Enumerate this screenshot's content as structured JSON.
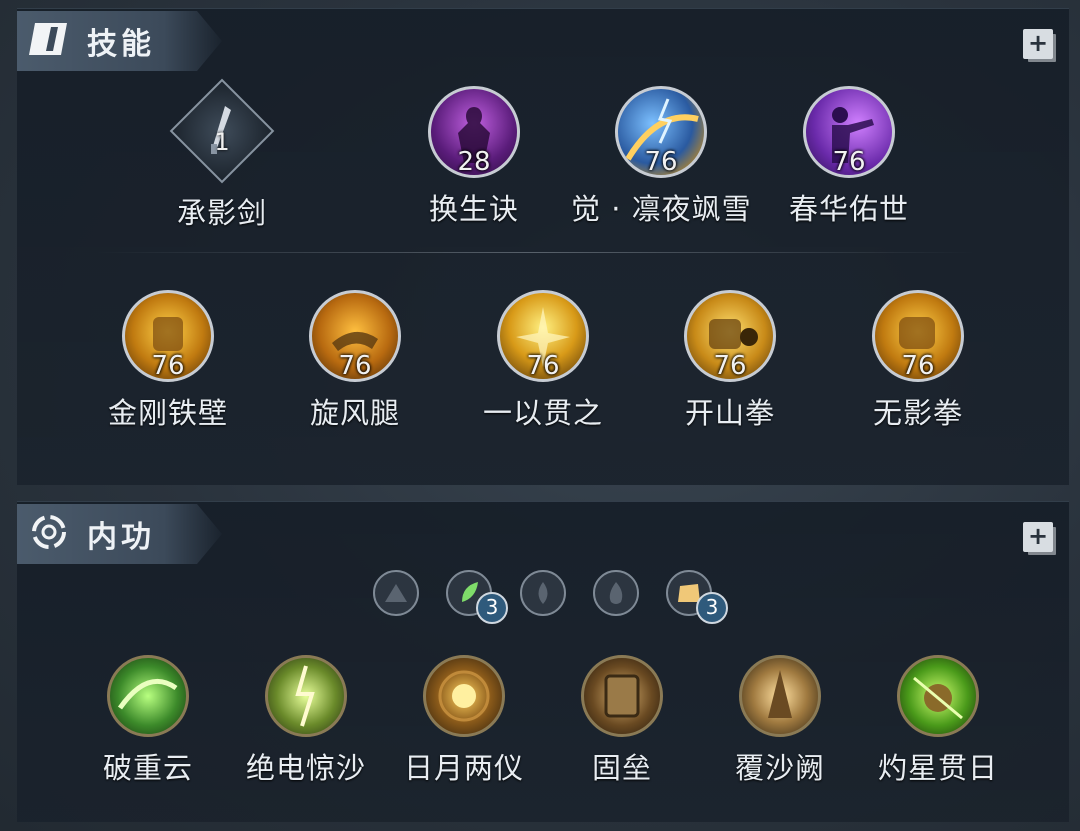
{
  "skills_section": {
    "title": "技能",
    "active": [
      {
        "name": "承影剑",
        "level": "1"
      },
      {
        "name": "换生诀",
        "level": "28"
      },
      {
        "name": "觉 · 凛夜飒雪",
        "level": "76"
      },
      {
        "name": "春华佑世",
        "level": "76"
      }
    ],
    "martial": [
      {
        "name": "金刚铁壁",
        "level": "76"
      },
      {
        "name": "旋风腿",
        "level": "76"
      },
      {
        "name": "一以贯之",
        "level": "76"
      },
      {
        "name": "开山拳",
        "level": "76"
      },
      {
        "name": "无影拳",
        "level": "76"
      }
    ],
    "add_label": "+"
  },
  "neigong_section": {
    "title": "内功",
    "elements": [
      {
        "icon": "mountain-icon",
        "count": ""
      },
      {
        "icon": "leaf-icon",
        "count": "3"
      },
      {
        "icon": "water-drop-icon",
        "count": ""
      },
      {
        "icon": "flame-icon",
        "count": ""
      },
      {
        "icon": "earth-block-icon",
        "count": "3"
      }
    ],
    "skills": [
      {
        "name": "破重云"
      },
      {
        "name": "绝电惊沙"
      },
      {
        "name": "日月两仪"
      },
      {
        "name": "固垒"
      },
      {
        "name": "覆沙阙"
      },
      {
        "name": "灼星贯日"
      }
    ],
    "add_label": "+"
  }
}
